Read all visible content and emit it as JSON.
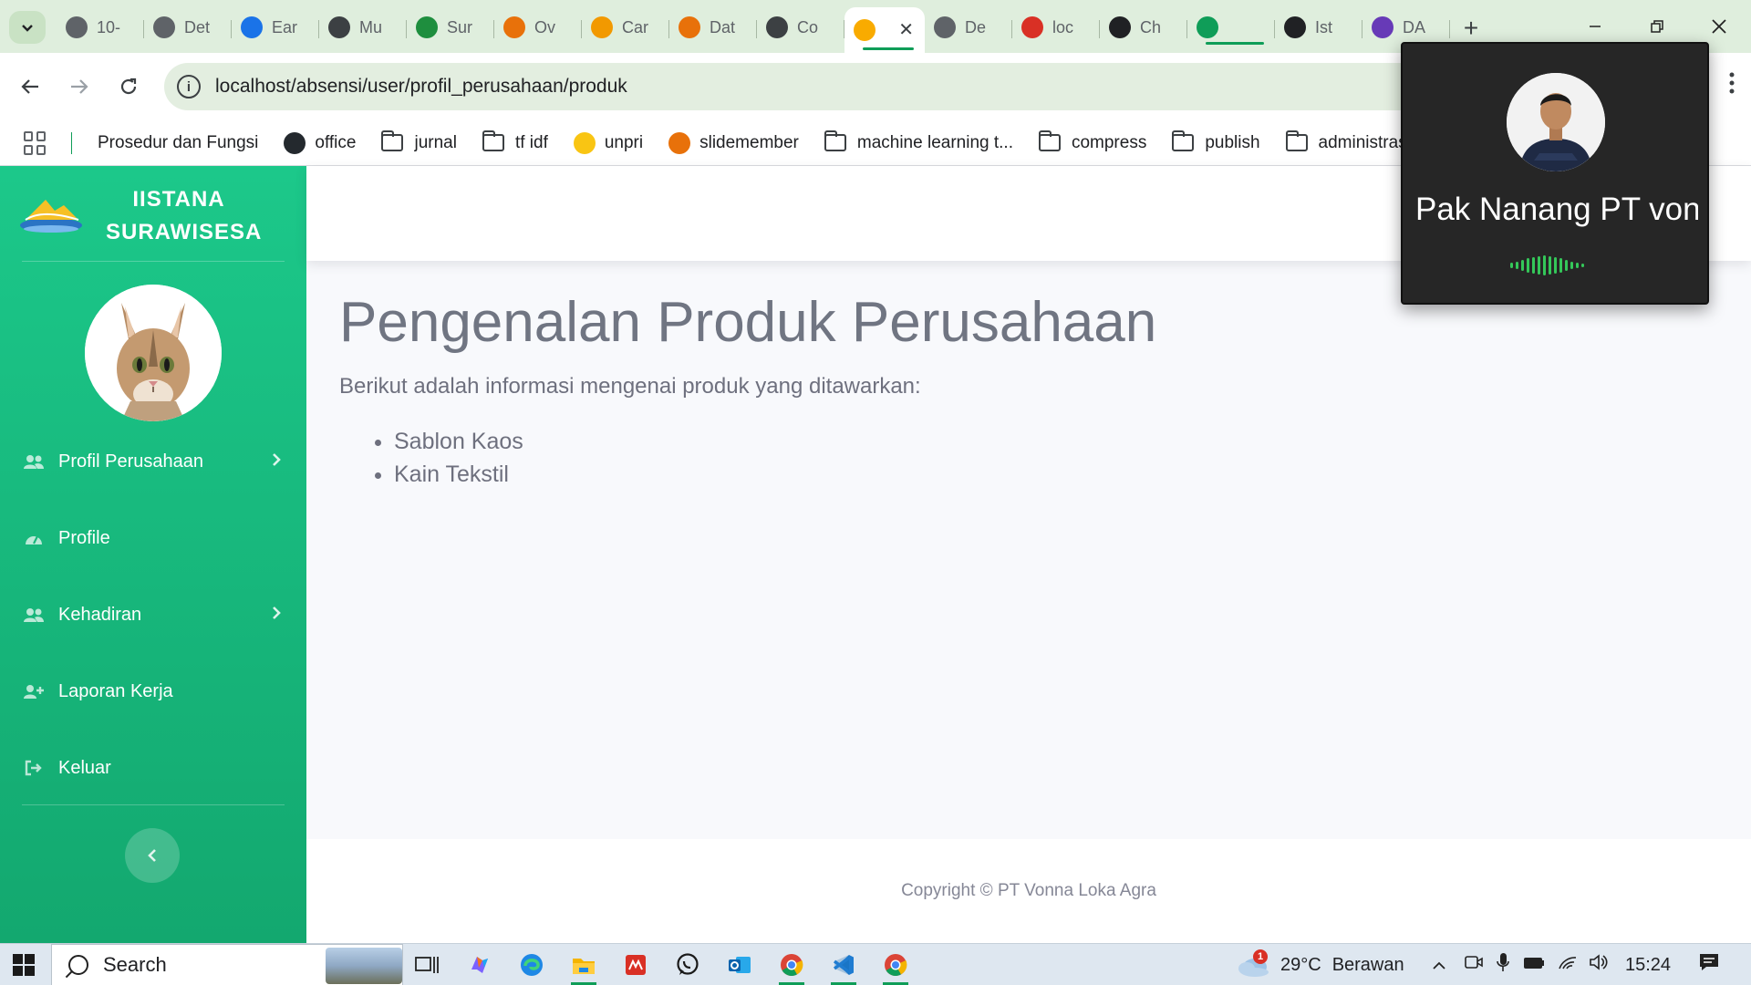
{
  "browser": {
    "tabs": [
      {
        "title": "10-",
        "icon": "globe-icon",
        "color": "#5f6368"
      },
      {
        "title": "Det",
        "icon": "spiral-icon",
        "color": "#5f6368"
      },
      {
        "title": "Ear",
        "icon": "google-drive-icon",
        "color": "#1a73e8"
      },
      {
        "title": "Mu",
        "icon": "lock-icon",
        "color": "#3c4043"
      },
      {
        "title": "Sur",
        "icon": "spinner-icon",
        "color": "#1e8e3e"
      },
      {
        "title": "Ov",
        "icon": "pinwheel-icon",
        "color": "#e8710a"
      },
      {
        "title": "Car",
        "icon": "orange-circle-icon",
        "color": "#f29900"
      },
      {
        "title": "Dat",
        "icon": "person-icon",
        "color": "#e8710a"
      },
      {
        "title": "Co",
        "icon": "ampersand-icon",
        "color": "#3c4043"
      },
      {
        "title": "",
        "icon": "site-logo-icon",
        "color": "#f9ab00",
        "active": true
      },
      {
        "title": "De",
        "icon": "globe-icon",
        "color": "#5f6368"
      },
      {
        "title": "loc",
        "icon": "pma-icon",
        "color": "#d93025"
      },
      {
        "title": "Ch",
        "icon": "chatgpt-icon",
        "color": "#202124"
      },
      {
        "title": "",
        "icon": "meet-icon",
        "color": "#0f9d58"
      },
      {
        "title": "Ist",
        "icon": "c-icon",
        "color": "#202124"
      },
      {
        "title": "DA",
        "icon": "form-icon",
        "color": "#673ab7"
      }
    ],
    "address_url": "localhost/absensi/user/profil_perusahaan/produk",
    "bookmarks": [
      {
        "label": "Prosedur dan Fungsi",
        "type": "none"
      },
      {
        "label": "office",
        "type": "github"
      },
      {
        "label": "jurnal",
        "type": "folder"
      },
      {
        "label": "tf idf",
        "type": "folder"
      },
      {
        "label": "unpri",
        "type": "jp"
      },
      {
        "label": "slidemember",
        "type": "slide"
      },
      {
        "label": "machine learning t...",
        "type": "folder"
      },
      {
        "label": "compress",
        "type": "folder"
      },
      {
        "label": "publish",
        "type": "folder"
      },
      {
        "label": "administrasi fik",
        "type": "folder"
      }
    ]
  },
  "sidebar": {
    "brand_line1": "IISTANA",
    "brand_line2": "SURAWISESA",
    "items": [
      {
        "label": "Profil Perusahaan",
        "icon": "users-icon",
        "has_submenu": true
      },
      {
        "label": "Profile",
        "icon": "gauge-icon",
        "has_submenu": false
      },
      {
        "label": "Kehadiran",
        "icon": "users-icon",
        "has_submenu": true
      },
      {
        "label": "Laporan Kerja",
        "icon": "user-plus-icon",
        "has_submenu": false
      },
      {
        "label": "Keluar",
        "icon": "sign-out-icon",
        "has_submenu": false
      }
    ]
  },
  "main": {
    "title": "Pengenalan Produk Perusahaan",
    "intro": "Berikut adalah informasi mengenai produk yang ditawarkan:",
    "products": [
      "Sablon Kaos",
      "Kain Tekstil"
    ],
    "footer": "Copyright © PT Vonna Loka Agra"
  },
  "call_overlay": {
    "name": "Pak Nanang PT von"
  },
  "taskbar": {
    "search_label": "Search",
    "weather_temp": "29°C",
    "weather_desc": "Berawan",
    "notification_count": "1",
    "time": "15:24"
  },
  "colors": {
    "sidebar_green": "#1cc88a",
    "tab_strip": "#dfeedd",
    "accent": "#0f9d58"
  }
}
